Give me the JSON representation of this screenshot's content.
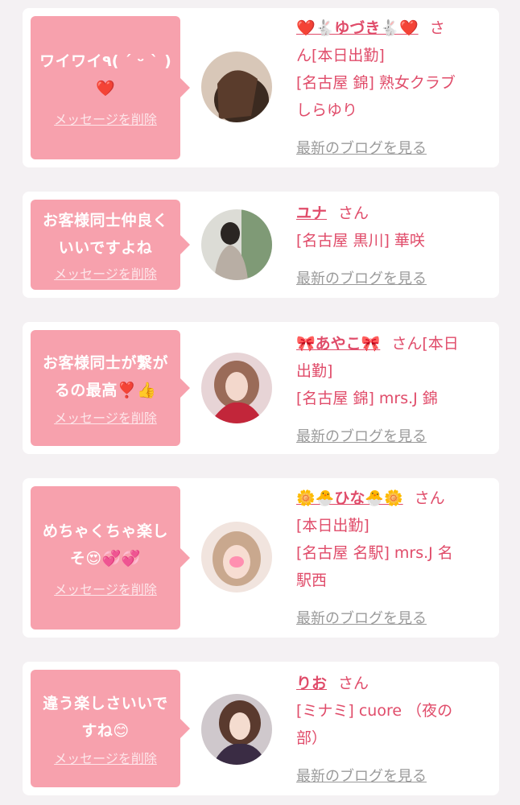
{
  "cards": [
    {
      "message": "ワイワイ٩( ´ ᵕ ` )\n❤️",
      "delete_label": "メッセージを削除",
      "name": "❤️🐇ゆづき🐇❤️",
      "honorific": "さ",
      "status_line": "ん[本日出勤]",
      "shop_lines": [
        "[名古屋 錦] 熟女クラブ",
        "しらゆり"
      ],
      "blog_link": "最新のブログを見る"
    },
    {
      "message": "お客様同士仲良く\nいいですよね",
      "delete_label": "メッセージを削除",
      "name": "ユナ",
      "honorific": "さん",
      "status_line": "",
      "shop_lines": [
        "[名古屋 黒川] 華咲"
      ],
      "blog_link": "最新のブログを見る"
    },
    {
      "message": "お客様同士が繋が\nるの最高❣️👍",
      "delete_label": "メッセージを削除",
      "name": "🎀あやこ🎀",
      "honorific": "さん[本日",
      "status_line": "出勤]",
      "shop_lines": [
        "[名古屋 錦] mrs.J 錦"
      ],
      "blog_link": "最新のブログを見る"
    },
    {
      "message": "めちゃくちゃ楽し\nそ😍💞💞",
      "delete_label": "メッセージを削除",
      "name": "🌼🐣ひな🐣🌼",
      "honorific": "さん",
      "status_line": "[本日出勤]",
      "shop_lines": [
        "[名古屋 名駅] mrs.J 名",
        "駅西"
      ],
      "blog_link": "最新のブログを見る"
    },
    {
      "message": "違う楽しさいいで\nすね😊",
      "delete_label": "メッセージを削除",
      "name": "りお",
      "honorific": "さん",
      "status_line": "",
      "shop_lines": [
        "[ミナミ] cuore （夜の",
        "部）"
      ],
      "blog_link": "最新のブログを見る"
    }
  ]
}
